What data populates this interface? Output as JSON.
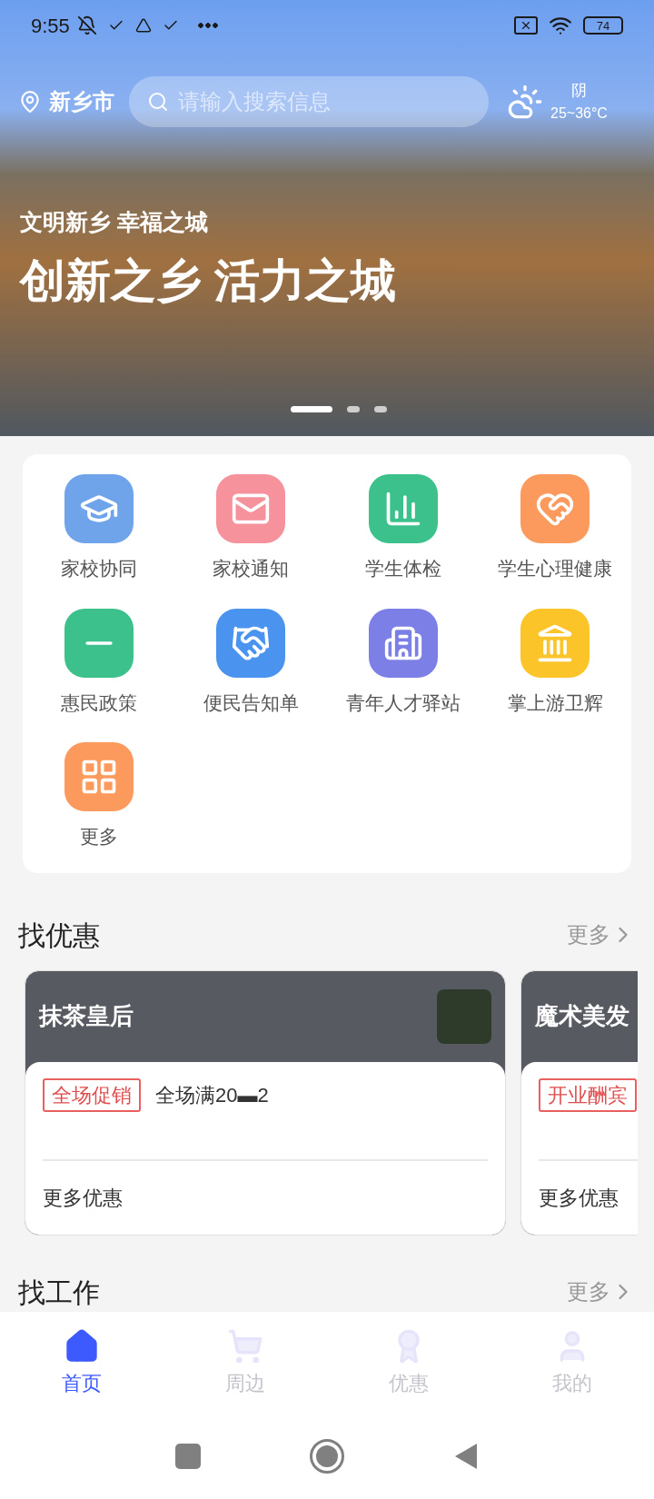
{
  "status_bar": {
    "time": "9:55",
    "battery": "74"
  },
  "header": {
    "city": "新乡市",
    "search": {
      "placeholder": "请输入搜索信息"
    },
    "weather": {
      "condition": "阴",
      "temperature": "25~36°C"
    }
  },
  "banner": {
    "subtitle": "文明新乡 幸福之城",
    "title": "创新之乡 活力之城",
    "dots": [
      {
        "selected": true
      },
      {
        "selected": false
      },
      {
        "selected": false
      }
    ]
  },
  "services": [
    {
      "label": "家校协同",
      "kind": "cap",
      "color": "#6fa3ea"
    },
    {
      "label": "家校通知",
      "kind": "mail",
      "color": "#f5929b"
    },
    {
      "label": "学生体检",
      "kind": "chart",
      "color": "#3cc18d"
    },
    {
      "label": "学生心理健康",
      "kind": "heart",
      "color": "#fb9a5c"
    },
    {
      "label": "惠民政策",
      "kind": "note",
      "color": "#3cc18d"
    },
    {
      "label": "便民告知单",
      "kind": "hand",
      "color": "#4a93ef"
    },
    {
      "label": "青年人才驿站",
      "kind": "building",
      "color": "#7b7fe6"
    },
    {
      "label": "掌上游卫辉",
      "kind": "pavilion",
      "color": "#fbc52a"
    },
    {
      "label": "更多",
      "kind": "grid",
      "color": "#fb9a5c"
    }
  ],
  "deals": {
    "title": "找优惠",
    "more": "更多",
    "cards": [
      {
        "name": "抹茶皇后",
        "photo": true,
        "tag": "全场促销",
        "offer": "全场满20▬2",
        "more": "更多优惠"
      },
      {
        "name": "魔术美发",
        "tag": "开业酬宾",
        "more": "更多优惠"
      }
    ]
  },
  "jobs": {
    "title": "找工作",
    "more": "更多"
  },
  "tab_bar": [
    {
      "label": "首页",
      "kind": "home",
      "selected": true
    },
    {
      "label": "周边",
      "kind": "cart",
      "selected": false
    },
    {
      "label": "优惠",
      "kind": "award",
      "selected": false
    },
    {
      "label": "我的",
      "kind": "user",
      "selected": false
    }
  ]
}
